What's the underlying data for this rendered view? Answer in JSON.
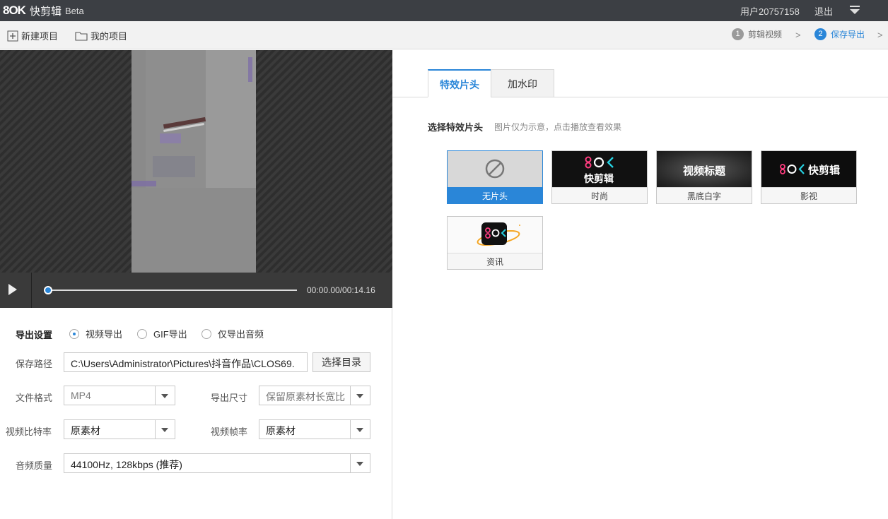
{
  "app": {
    "logo_mark": "8OK",
    "name": "快剪辑",
    "beta": "Beta",
    "user": "用户20757158",
    "logout": "退出"
  },
  "toolbar": {
    "new_project": "新建项目",
    "my_projects": "我的项目",
    "steps": [
      {
        "num": "1",
        "label": "剪辑视频"
      },
      {
        "num": "2",
        "label": "保存导出"
      }
    ]
  },
  "player": {
    "time": "00:00.00/00:14.16",
    "progress": 0
  },
  "export": {
    "title": "导出设置",
    "modes": [
      "视频导出",
      "GIF导出",
      "仅导出音频"
    ],
    "selected_mode": "视频导出",
    "path_label": "保存路径",
    "path_value": "C:\\Users\\Administrator\\Pictures\\抖音作品\\CLOS69.",
    "choose_dir": "选择目录",
    "format_label": "文件格式",
    "format_value": "MP4",
    "size_label": "导出尺寸",
    "size_value": "保留原素材长宽比",
    "bitrate_label": "视频比特率",
    "bitrate_value": "原素材",
    "fps_label": "视频帧率",
    "fps_value": "原素材",
    "audio_label": "音频质量",
    "audio_value": "44100Hz, 128kbps (推荐)"
  },
  "right": {
    "tabs": [
      "特效片头",
      "加水印"
    ],
    "section_title": "选择特效片头",
    "section_hint": "图片仅为示意，点击播放查看效果",
    "cards": [
      {
        "label": "无片头",
        "selected": true
      },
      {
        "label": "时尚",
        "thumb_text": "快剪辑",
        "thumb_mark": "8OK"
      },
      {
        "label": "黑底白字",
        "thumb_text": "视频标题"
      },
      {
        "label": "影视",
        "thumb_text": "快剪辑",
        "thumb_mark": "8OK"
      },
      {
        "label": "资讯",
        "thumb_mark": "8OK"
      }
    ]
  },
  "colors": {
    "accent": "#2a86d8",
    "titlebar": "#3c3f44",
    "logo_pink": "#ff3d7f",
    "logo_cyan": "#26d0e0"
  }
}
